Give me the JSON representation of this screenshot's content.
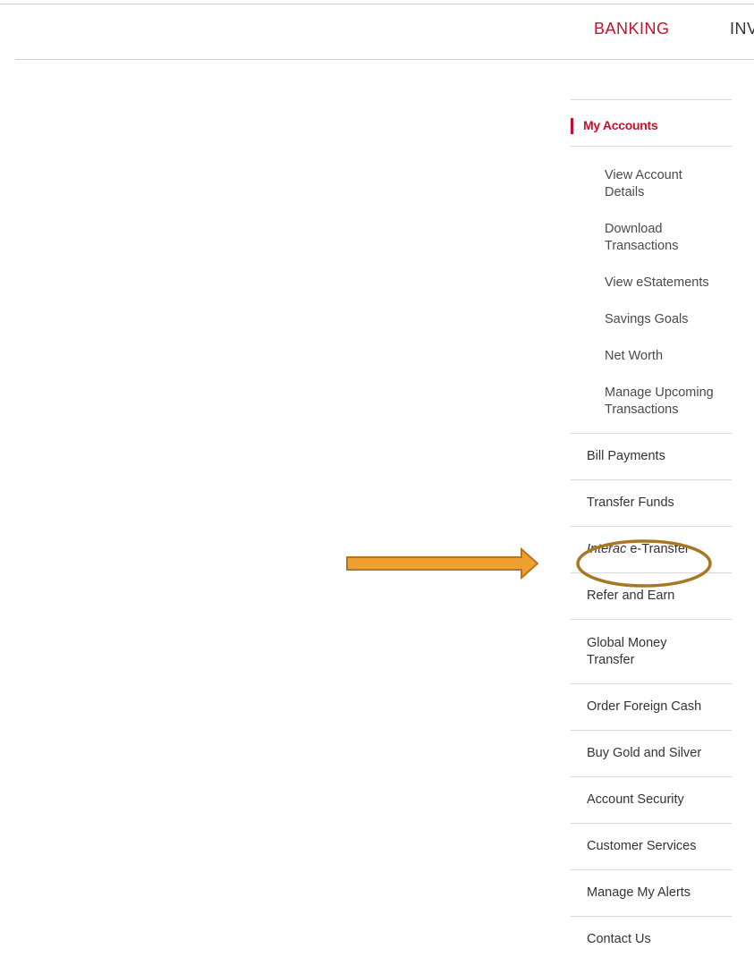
{
  "nav": {
    "banking_label": "BANKING",
    "investing_label": "INVESTING"
  },
  "sidebar": {
    "section_title": "My Accounts",
    "sub_items": [
      "View Account\nDetails",
      "Download\nTransactions",
      "View eStatements",
      "Savings Goals",
      "Net Worth",
      "Manage Upcoming\nTransactions"
    ],
    "items": {
      "bill_payments": "Bill Payments",
      "transfer_funds": "Transfer Funds",
      "interac_brand": "Interac",
      "interac_rest": " e-Transfer",
      "refer_and_earn": "Refer and Earn",
      "global_money_line1": "Global Money",
      "global_money_line2": "Transfer",
      "order_foreign_cash": "Order Foreign Cash",
      "buy_gold_silver": "Buy Gold and Silver",
      "account_security": "Account Security",
      "customer_services": "Customer Services",
      "manage_alerts": "Manage My Alerts",
      "contact_us": "Contact Us"
    }
  },
  "colors": {
    "accent": "#c8102e",
    "arrow_fill": "#f0a030",
    "arrow_stroke": "#b8751f",
    "highlight_ring": "#a87722"
  },
  "icons": {
    "arrow": "right-arrow-annotation",
    "highlight": "ellipse-highlight-annotation"
  }
}
